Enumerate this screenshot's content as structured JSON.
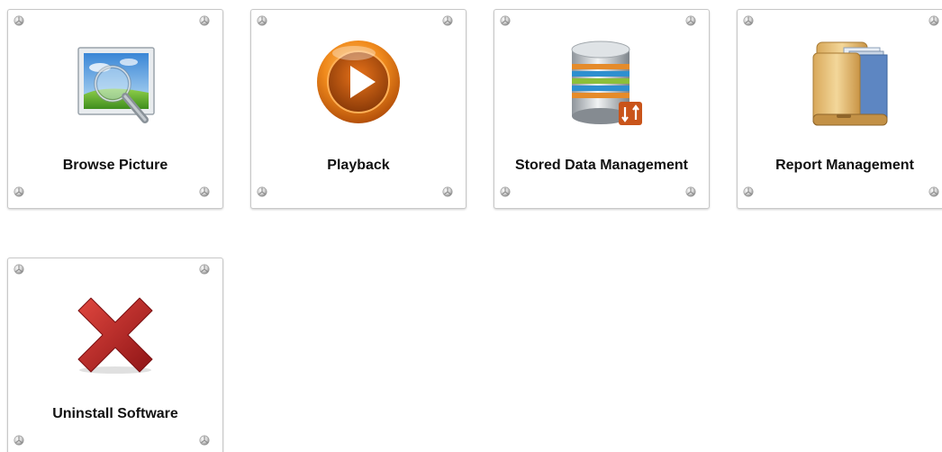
{
  "tiles": [
    {
      "label": "Browse Picture",
      "icon": "browse-picture-icon"
    },
    {
      "label": "Playback",
      "icon": "playback-icon"
    },
    {
      "label": "Stored Data Management",
      "icon": "database-icon"
    },
    {
      "label": "Report Management",
      "icon": "folder-icon"
    },
    {
      "label": "Uninstall Software",
      "icon": "uninstall-x-icon"
    }
  ],
  "colors": {
    "tile_border": "#c8c8c8",
    "label_text": "#111111",
    "uninstall_red": "#c0282a",
    "playback_orange": "#f08a1c"
  }
}
